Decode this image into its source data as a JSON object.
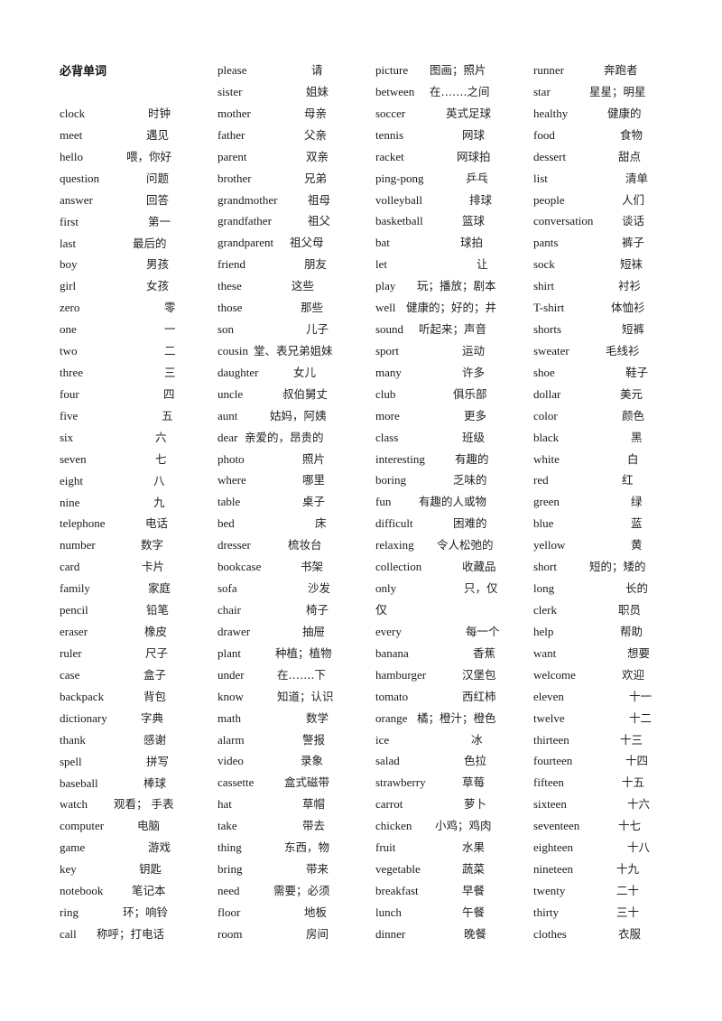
{
  "document": {
    "title": "必背单词",
    "columns": [
      {
        "entries": [
          {
            "en": "clock",
            "zh": "时钟"
          },
          {
            "en": "meet",
            "zh": "遇见"
          },
          {
            "en": "hello",
            "zh": "喂，你好"
          },
          {
            "en": "question",
            "zh": "问题"
          },
          {
            "en": "answer",
            "zh": "回答"
          },
          {
            "en": "first",
            "zh": "第一"
          },
          {
            "en": "last",
            "zh": "最后的"
          },
          {
            "en": "boy",
            "zh": "男孩"
          },
          {
            "en": "girl",
            "zh": "女孩"
          },
          {
            "en": "zero",
            "zh": "零"
          },
          {
            "en": "one",
            "zh": "一"
          },
          {
            "en": "two",
            "zh": "二"
          },
          {
            "en": "three",
            "zh": "三"
          },
          {
            "en": "four",
            "zh": "四"
          },
          {
            "en": "five",
            "zh": "五"
          },
          {
            "en": "six",
            "zh": "六"
          },
          {
            "en": "seven",
            "zh": "七"
          },
          {
            "en": "eight",
            "zh": "八"
          },
          {
            "en": "nine",
            "zh": "九"
          },
          {
            "en": "telephone",
            "zh": "电话"
          },
          {
            "en": "number",
            "zh": "数字"
          },
          {
            "en": "card",
            "zh": "卡片"
          },
          {
            "en": "family",
            "zh": "家庭"
          },
          {
            "en": "pencil",
            "zh": "铅笔"
          },
          {
            "en": "eraser",
            "zh": "橡皮"
          },
          {
            "en": "ruler",
            "zh": "尺子"
          },
          {
            "en": "case",
            "zh": "盒子"
          },
          {
            "en": "backpack",
            "zh": "背包"
          },
          {
            "en": "dictionary",
            "zh": "字典"
          },
          {
            "en": "thank",
            "zh": "感谢"
          },
          {
            "en": "spell",
            "zh": "拼写"
          },
          {
            "en": "baseball",
            "zh": "棒球"
          },
          {
            "en": "watch",
            "zh": "观看；  手表"
          },
          {
            "en": "computer",
            "zh": "电脑"
          },
          {
            "en": "game",
            "zh": "游戏"
          },
          {
            "en": "key",
            "zh": "钥匙"
          },
          {
            "en": "notebook",
            "zh": "笔记本"
          },
          {
            "en": "ring",
            "zh": "环；响铃"
          },
          {
            "en": "call",
            "zh": "称呼；打电话"
          }
        ]
      },
      {
        "entries": [
          {
            "en": "please",
            "zh": "请"
          },
          {
            "en": "sister",
            "zh": "姐妹"
          },
          {
            "en": "mother",
            "zh": "母亲"
          },
          {
            "en": "father",
            "zh": "父亲"
          },
          {
            "en": "parent",
            "zh": "双亲"
          },
          {
            "en": "brother",
            "zh": "兄弟"
          },
          {
            "en": "grandmother",
            "zh": "祖母"
          },
          {
            "en": "grandfather",
            "zh": "祖父"
          },
          {
            "en": "grandparent",
            "zh": "祖父母"
          },
          {
            "en": "friend",
            "zh": "朋友"
          },
          {
            "en": "these",
            "zh": "这些"
          },
          {
            "en": "those",
            "zh": "那些"
          },
          {
            "en": "son",
            "zh": "儿子"
          },
          {
            "en": "cousin",
            "zh": "堂、表兄弟姐妹"
          },
          {
            "en": "daughter",
            "zh": "女儿"
          },
          {
            "en": "uncle",
            "zh": "叔伯舅丈"
          },
          {
            "en": "aunt",
            "zh": "姑妈，阿姨"
          },
          {
            "en": "dear",
            "zh": "亲爱的，昂贵的"
          },
          {
            "en": "photo",
            "zh": "照片"
          },
          {
            "en": "where",
            "zh": "哪里"
          },
          {
            "en": "table",
            "zh": "桌子"
          },
          {
            "en": "bed",
            "zh": "床"
          },
          {
            "en": "dresser",
            "zh": "梳妆台"
          },
          {
            "en": "bookcase",
            "zh": "书架"
          },
          {
            "en": "sofa",
            "zh": "沙发"
          },
          {
            "en": "chair",
            "zh": "椅子"
          },
          {
            "en": "drawer",
            "zh": "抽屉"
          },
          {
            "en": "plant",
            "zh": "种植；植物"
          },
          {
            "en": "under",
            "zh": "在…….下"
          },
          {
            "en": "know",
            "zh": "知道；认识"
          },
          {
            "en": "math",
            "zh": "数学"
          },
          {
            "en": "alarm",
            "zh": "警报"
          },
          {
            "en": "video",
            "zh": "录象"
          },
          {
            "en": "cassette",
            "zh": "盒式磁带"
          },
          {
            "en": "hat",
            "zh": "草帽"
          },
          {
            "en": "take",
            "zh": "带去"
          },
          {
            "en": "thing",
            "zh": "东西，物"
          },
          {
            "en": "bring",
            "zh": "带来"
          },
          {
            "en": "need",
            "zh": "需要；必须"
          },
          {
            "en": "floor",
            "zh": "地板"
          },
          {
            "en": "room",
            "zh": "房间"
          }
        ]
      },
      {
        "entries": [
          {
            "en": "picture",
            "zh": "图画；照片"
          },
          {
            "en": "between",
            "zh": "在…….之间"
          },
          {
            "en": "soccer",
            "zh": "英式足球"
          },
          {
            "en": "tennis",
            "zh": "网球"
          },
          {
            "en": "racket",
            "zh": "网球拍"
          },
          {
            "en": "ping-pong",
            "zh": "乒乓"
          },
          {
            "en": "volleyball",
            "zh": "排球"
          },
          {
            "en": "basketball",
            "zh": "篮球"
          },
          {
            "en": "bat",
            "zh": "球拍"
          },
          {
            "en": "let",
            "zh": "让"
          },
          {
            "en": "play",
            "zh": "玩；播放；剧本"
          },
          {
            "en": "well",
            "zh": "健康的；好的；井"
          },
          {
            "en": "sound",
            "zh": "听起来；声音"
          },
          {
            "en": "sport",
            "zh": "运动"
          },
          {
            "en": "many",
            "zh": "许多"
          },
          {
            "en": "club",
            "zh": "俱乐部"
          },
          {
            "en": "more",
            "zh": "更多"
          },
          {
            "en": "class",
            "zh": "班级"
          },
          {
            "en": "interesting",
            "zh": "有趣的"
          },
          {
            "en": "boring",
            "zh": "乏味的"
          },
          {
            "en": "fun",
            "zh": "有趣的人或物"
          },
          {
            "en": "difficult",
            "zh": "困难的"
          },
          {
            "en": "relaxing",
            "zh": "令人松弛的"
          },
          {
            "en": "collection",
            "zh": "收藏品"
          },
          {
            "en": "only",
            "zh": "只，仅"
          },
          {
            "en": "仅",
            "zh": ""
          },
          {
            "en": "every",
            "zh": "每一个"
          },
          {
            "en": "banana",
            "zh": "香蕉"
          },
          {
            "en": "hamburger",
            "zh": "汉堡包"
          },
          {
            "en": "tomato",
            "zh": "西红柿"
          },
          {
            "en": "orange",
            "zh": "橘；橙汁；橙色"
          },
          {
            "en": "ice",
            "zh": "冰"
          },
          {
            "en": "salad",
            "zh": "色拉"
          },
          {
            "en": "strawberry",
            "zh": "草莓"
          },
          {
            "en": "carrot",
            "zh": "萝卜"
          },
          {
            "en": "chicken",
            "zh": "小鸡；鸡肉"
          },
          {
            "en": "fruit",
            "zh": "水果"
          },
          {
            "en": "vegetable",
            "zh": "蔬菜"
          },
          {
            "en": "breakfast",
            "zh": "早餐"
          },
          {
            "en": "lunch",
            "zh": "午餐"
          },
          {
            "en": "dinner",
            "zh": "晚餐"
          }
        ]
      },
      {
        "entries": [
          {
            "en": "runner",
            "zh": "奔跑者"
          },
          {
            "en": "star",
            "zh": "星星；明星"
          },
          {
            "en": "healthy",
            "zh": "健康的"
          },
          {
            "en": "food",
            "zh": "食物"
          },
          {
            "en": "dessert",
            "zh": "甜点"
          },
          {
            "en": "list",
            "zh": "清单"
          },
          {
            "en": "people",
            "zh": "人们"
          },
          {
            "en": "conversation",
            "zh": "谈话"
          },
          {
            "en": "pants",
            "zh": "裤子"
          },
          {
            "en": "sock",
            "zh": "短袜"
          },
          {
            "en": "shirt",
            "zh": "衬衫"
          },
          {
            "en": "T-shirt",
            "zh": "体恤衫"
          },
          {
            "en": "shorts",
            "zh": "短裤"
          },
          {
            "en": "sweater",
            "zh": "毛线衫"
          },
          {
            "en": "shoe",
            "zh": "鞋子"
          },
          {
            "en": "dollar",
            "zh": "美元"
          },
          {
            "en": "color",
            "zh": "颜色"
          },
          {
            "en": "black",
            "zh": "黑"
          },
          {
            "en": "white",
            "zh": "白"
          },
          {
            "en": "red",
            "zh": "红"
          },
          {
            "en": "green",
            "zh": "绿"
          },
          {
            "en": "blue",
            "zh": "蓝"
          },
          {
            "en": "yellow",
            "zh": "黄"
          },
          {
            "en": "short",
            "zh": "短的；矮的"
          },
          {
            "en": "long",
            "zh": "长的"
          },
          {
            "en": "clerk",
            "zh": "职员"
          },
          {
            "en": "help",
            "zh": "帮助"
          },
          {
            "en": "want",
            "zh": "想要"
          },
          {
            "en": "welcome",
            "zh": "欢迎"
          },
          {
            "en": "eleven",
            "zh": "十一"
          },
          {
            "en": "twelve",
            "zh": "十二"
          },
          {
            "en": "thirteen",
            "zh": "十三"
          },
          {
            "en": "fourteen",
            "zh": "十四"
          },
          {
            "en": "fifteen",
            "zh": "十五"
          },
          {
            "en": "sixteen",
            "zh": "十六"
          },
          {
            "en": "seventeen",
            "zh": "十七"
          },
          {
            "en": "eighteen",
            "zh": "十八"
          },
          {
            "en": "nineteen",
            "zh": "十九"
          },
          {
            "en": "twenty",
            "zh": "二十"
          },
          {
            "en": "thirty",
            "zh": "三十"
          },
          {
            "en": "clothes",
            "zh": "衣服"
          }
        ]
      }
    ]
  }
}
